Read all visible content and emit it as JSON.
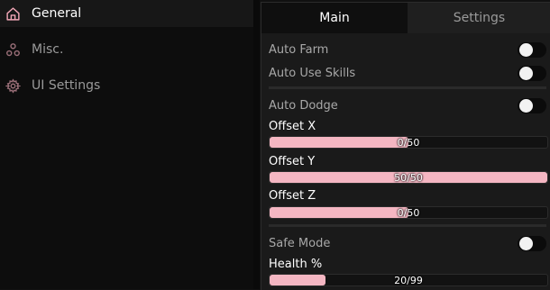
{
  "sidebar": {
    "items": [
      {
        "label": "General",
        "icon": "home-icon"
      },
      {
        "label": "Misc.",
        "icon": "nodes-icon"
      },
      {
        "label": "UI Settings",
        "icon": "gear-icon"
      }
    ]
  },
  "tabs": {
    "main": "Main",
    "settings": "Settings"
  },
  "toggles": {
    "auto_farm": "Auto Farm",
    "auto_use_skills": "Auto Use Skills",
    "auto_dodge": "Auto Dodge",
    "safe_mode": "Safe Mode"
  },
  "sliders": {
    "offset_x": {
      "label": "Offset X",
      "display": "0/50",
      "fraction": 0.5
    },
    "offset_y": {
      "label": "Offset Y",
      "display": "50/50",
      "fraction": 1.0
    },
    "offset_z": {
      "label": "Offset Z",
      "display": "0/50",
      "fraction": 0.5
    },
    "health": {
      "label": "Health %",
      "display": "20/99",
      "fraction": 0.2
    }
  },
  "colors": {
    "accent": "#f4b6c2",
    "background": "#111111",
    "panel": "#1a1a1a"
  }
}
